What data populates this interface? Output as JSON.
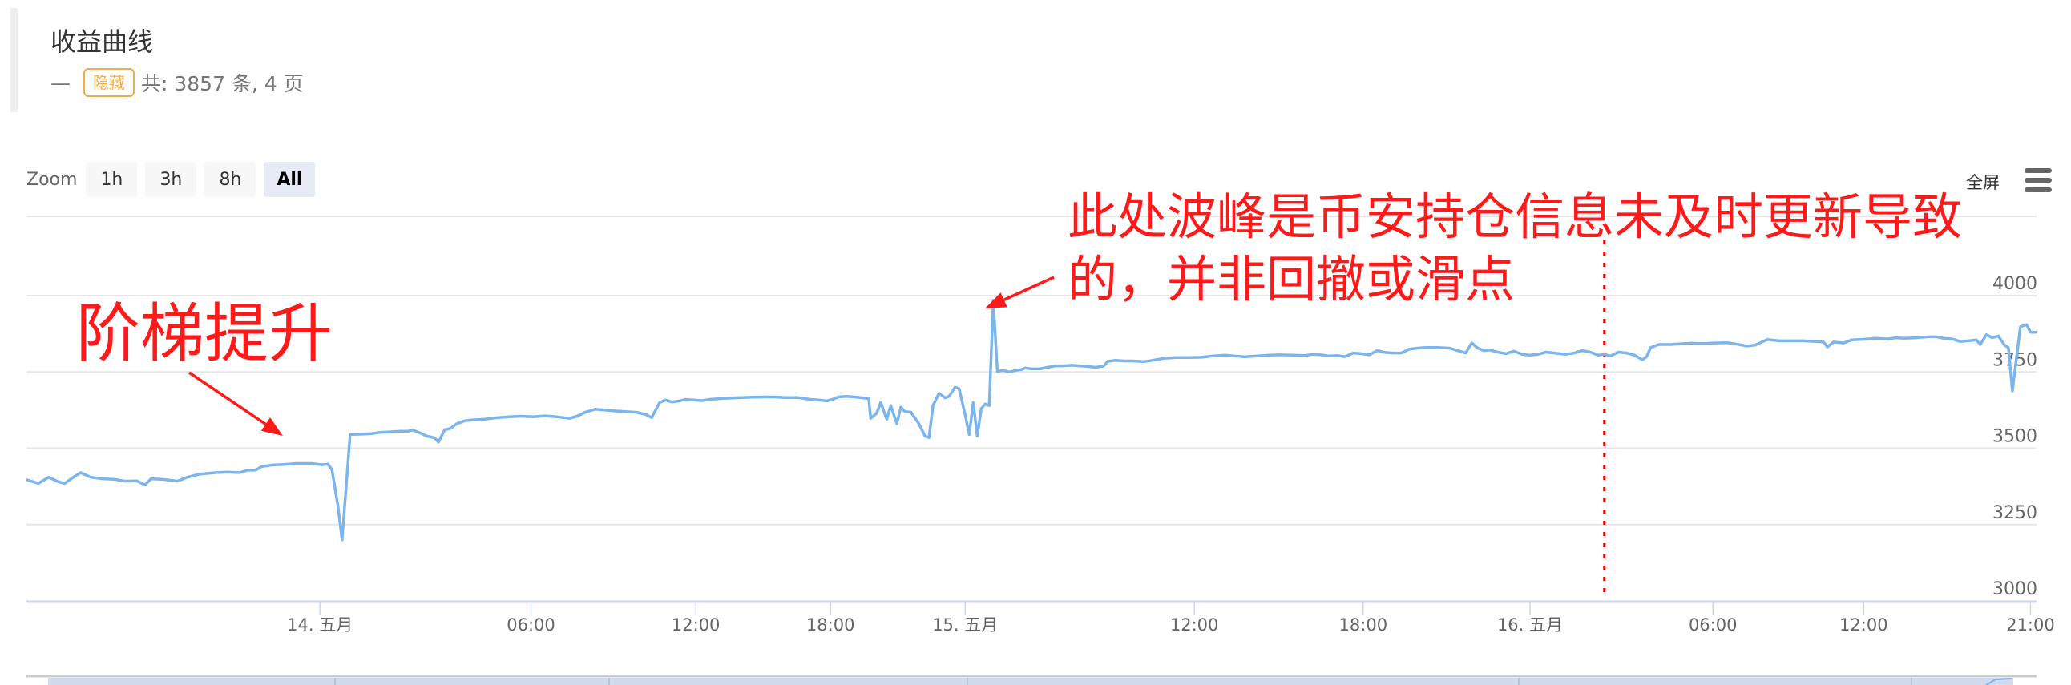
{
  "header": {
    "title": "收益曲线",
    "dash": "—",
    "badge": "隐藏",
    "summary": "共: 3857 条, 4 页"
  },
  "toolbar": {
    "zoom_label": "Zoom",
    "zoom_buttons": [
      {
        "label": "1h",
        "active": false
      },
      {
        "label": "3h",
        "active": false
      },
      {
        "label": "8h",
        "active": false
      },
      {
        "label": "All",
        "active": true
      }
    ],
    "fullscreen_label": "全屏",
    "menu_icon": "hamburger-menu-icon"
  },
  "annotations": {
    "step_up": "阶梯提升",
    "peak_line1": "此处波峰是币安持仓信息未及时更新导致",
    "peak_line2": "的，并非回撤或滑点",
    "color": "#ff1a1a"
  },
  "chart_data": {
    "type": "line",
    "title": "收益曲线",
    "xlabel": "",
    "ylabel": "",
    "ylim": [
      3000,
      4000
    ],
    "yticks": [
      3000,
      3250,
      3500,
      3750,
      4000
    ],
    "grid": true,
    "x_axis_note": "ordinal time axis; x values are positions along axis (0 = left edge, 1000 = right edge)",
    "xlim": [
      0,
      1000
    ],
    "xticks": [
      {
        "label": "14. 五月",
        "x": 146
      },
      {
        "label": "06:00",
        "x": 251
      },
      {
        "label": "12:00",
        "x": 333
      },
      {
        "label": "18:00",
        "x": 400
      },
      {
        "label": "15. 五月",
        "x": 467
      },
      {
        "label": "12:00",
        "x": 581
      },
      {
        "label": "18:00",
        "x": 665
      },
      {
        "label": "16. 五月",
        "x": 748
      },
      {
        "label": "06:00",
        "x": 839
      },
      {
        "label": "12:00",
        "x": 914
      },
      {
        "label": "21:00",
        "x": 997
      }
    ],
    "marker_line_x": 785,
    "series": [
      {
        "name": "收益",
        "color": "#7cb5ec",
        "points": [
          [
            0,
            3397
          ],
          [
            6,
            3385
          ],
          [
            11,
            3405
          ],
          [
            16,
            3390
          ],
          [
            19,
            3385
          ],
          [
            24,
            3408
          ],
          [
            27,
            3420
          ],
          [
            32,
            3405
          ],
          [
            38,
            3400
          ],
          [
            44,
            3398
          ],
          [
            49,
            3392
          ],
          [
            55,
            3393
          ],
          [
            59,
            3380
          ],
          [
            62,
            3400
          ],
          [
            68,
            3398
          ],
          [
            75,
            3392
          ],
          [
            80,
            3405
          ],
          [
            86,
            3415
          ],
          [
            94,
            3420
          ],
          [
            100,
            3422
          ],
          [
            106,
            3420
          ],
          [
            110,
            3428
          ],
          [
            114,
            3428
          ],
          [
            117,
            3440
          ],
          [
            122,
            3445
          ],
          [
            128,
            3447
          ],
          [
            134,
            3450
          ],
          [
            142,
            3450
          ],
          [
            147,
            3446
          ],
          [
            150,
            3448
          ],
          [
            152,
            3430
          ],
          [
            155,
            3310
          ],
          [
            157,
            3200
          ],
          [
            159,
            3370
          ],
          [
            161,
            3545
          ],
          [
            166,
            3546
          ],
          [
            172,
            3548
          ],
          [
            176,
            3552
          ],
          [
            180,
            3553
          ],
          [
            186,
            3556
          ],
          [
            190,
            3556
          ],
          [
            192,
            3560
          ],
          [
            196,
            3550
          ],
          [
            199,
            3540
          ],
          [
            203,
            3534
          ],
          [
            205,
            3520
          ],
          [
            208,
            3560
          ],
          [
            211,
            3565
          ],
          [
            214,
            3580
          ],
          [
            218,
            3590
          ],
          [
            222,
            3593
          ],
          [
            228,
            3595
          ],
          [
            234,
            3600
          ],
          [
            240,
            3603
          ],
          [
            246,
            3605
          ],
          [
            252,
            3603
          ],
          [
            258,
            3606
          ],
          [
            264,
            3603
          ],
          [
            270,
            3598
          ],
          [
            274,
            3605
          ],
          [
            278,
            3618
          ],
          [
            283,
            3628
          ],
          [
            288,
            3625
          ],
          [
            293,
            3622
          ],
          [
            298,
            3620
          ],
          [
            303,
            3618
          ],
          [
            308,
            3611
          ],
          [
            311,
            3600
          ],
          [
            313,
            3625
          ],
          [
            315,
            3650
          ],
          [
            318,
            3658
          ],
          [
            321,
            3652
          ],
          [
            324,
            3654
          ],
          [
            328,
            3660
          ],
          [
            332,
            3658
          ],
          [
            336,
            3656
          ],
          [
            340,
            3660
          ],
          [
            346,
            3663
          ],
          [
            352,
            3665
          ],
          [
            360,
            3667
          ],
          [
            366,
            3668
          ],
          [
            372,
            3668
          ],
          [
            378,
            3666
          ],
          [
            384,
            3666
          ],
          [
            390,
            3660
          ],
          [
            394,
            3658
          ],
          [
            398,
            3655
          ],
          [
            401,
            3660
          ],
          [
            404,
            3668
          ],
          [
            408,
            3670
          ],
          [
            412,
            3668
          ],
          [
            416,
            3665
          ],
          [
            419,
            3663
          ],
          [
            420,
            3598
          ],
          [
            423,
            3615
          ],
          [
            425,
            3650
          ],
          [
            428,
            3595
          ],
          [
            430,
            3640
          ],
          [
            433,
            3580
          ],
          [
            435,
            3635
          ],
          [
            437,
            3620
          ],
          [
            440,
            3618
          ],
          [
            444,
            3580
          ],
          [
            447,
            3540
          ],
          [
            449,
            3535
          ],
          [
            451,
            3640
          ],
          [
            454,
            3680
          ],
          [
            457,
            3665
          ],
          [
            459,
            3670
          ],
          [
            462,
            3700
          ],
          [
            464,
            3695
          ],
          [
            467,
            3610
          ],
          [
            469,
            3545
          ],
          [
            471,
            3650
          ],
          [
            473,
            3540
          ],
          [
            475,
            3630
          ],
          [
            477,
            3645
          ],
          [
            479,
            3640
          ],
          [
            481,
            3985
          ],
          [
            483,
            3752
          ],
          [
            486,
            3755
          ],
          [
            489,
            3750
          ],
          [
            492,
            3755
          ],
          [
            495,
            3758
          ],
          [
            497,
            3763
          ],
          [
            500,
            3760
          ],
          [
            504,
            3760
          ],
          [
            508,
            3765
          ],
          [
            512,
            3770
          ],
          [
            516,
            3770
          ],
          [
            520,
            3772
          ],
          [
            524,
            3770
          ],
          [
            528,
            3768
          ],
          [
            532,
            3765
          ],
          [
            536,
            3770
          ],
          [
            538,
            3785
          ],
          [
            542,
            3788
          ],
          [
            546,
            3786
          ],
          [
            550,
            3786
          ],
          [
            556,
            3784
          ],
          [
            560,
            3788
          ],
          [
            566,
            3795
          ],
          [
            572,
            3797
          ],
          [
            578,
            3797
          ],
          [
            584,
            3798
          ],
          [
            590,
            3802
          ],
          [
            596,
            3805
          ],
          [
            600,
            3803
          ],
          [
            606,
            3800
          ],
          [
            612,
            3802
          ],
          [
            618,
            3805
          ],
          [
            624,
            3806
          ],
          [
            630,
            3805
          ],
          [
            636,
            3804
          ],
          [
            640,
            3808
          ],
          [
            644,
            3806
          ],
          [
            648,
            3802
          ],
          [
            652,
            3804
          ],
          [
            656,
            3800
          ],
          [
            660,
            3812
          ],
          [
            664,
            3810
          ],
          [
            668,
            3806
          ],
          [
            672,
            3820
          ],
          [
            676,
            3814
          ],
          [
            680,
            3812
          ],
          [
            684,
            3812
          ],
          [
            688,
            3825
          ],
          [
            692,
            3828
          ],
          [
            696,
            3830
          ],
          [
            702,
            3830
          ],
          [
            708,
            3828
          ],
          [
            712,
            3820
          ],
          [
            716,
            3812
          ],
          [
            719,
            3845
          ],
          [
            722,
            3828
          ],
          [
            725,
            3820
          ],
          [
            728,
            3822
          ],
          [
            732,
            3815
          ],
          [
            736,
            3810
          ],
          [
            740,
            3818
          ],
          [
            744,
            3808
          ],
          [
            748,
            3805
          ],
          [
            752,
            3808
          ],
          [
            756,
            3815
          ],
          [
            760,
            3812
          ],
          [
            766,
            3808
          ],
          [
            770,
            3812
          ],
          [
            774,
            3820
          ],
          [
            778,
            3815
          ],
          [
            782,
            3805
          ],
          [
            785,
            3808
          ],
          [
            788,
            3802
          ],
          [
            792,
            3815
          ],
          [
            796,
            3812
          ],
          [
            800,
            3805
          ],
          [
            804,
            3790
          ],
          [
            806,
            3800
          ],
          [
            808,
            3830
          ],
          [
            812,
            3840
          ],
          [
            818,
            3840
          ],
          [
            822,
            3842
          ],
          [
            828,
            3844
          ],
          [
            834,
            3843
          ],
          [
            840,
            3845
          ],
          [
            846,
            3846
          ],
          [
            850,
            3842
          ],
          [
            856,
            3835
          ],
          [
            860,
            3838
          ],
          [
            866,
            3856
          ],
          [
            872,
            3852
          ],
          [
            878,
            3852
          ],
          [
            884,
            3852
          ],
          [
            890,
            3850
          ],
          [
            894,
            3848
          ],
          [
            896,
            3832
          ],
          [
            899,
            3848
          ],
          [
            904,
            3845
          ],
          [
            908,
            3855
          ],
          [
            914,
            3857
          ],
          [
            920,
            3860
          ],
          [
            926,
            3858
          ],
          [
            930,
            3862
          ],
          [
            934,
            3860
          ],
          [
            940,
            3862
          ],
          [
            946,
            3865
          ],
          [
            950,
            3865
          ],
          [
            954,
            3860
          ],
          [
            958,
            3858
          ],
          [
            962,
            3850
          ],
          [
            966,
            3852
          ],
          [
            970,
            3855
          ],
          [
            972,
            3840
          ],
          [
            975,
            3872
          ],
          [
            978,
            3862
          ],
          [
            981,
            3868
          ],
          [
            984,
            3838
          ],
          [
            986,
            3830
          ],
          [
            988,
            3688
          ],
          [
            990,
            3795
          ],
          [
            992,
            3898
          ],
          [
            995,
            3905
          ],
          [
            997,
            3880
          ],
          [
            1000,
            3880
          ]
        ]
      }
    ]
  }
}
